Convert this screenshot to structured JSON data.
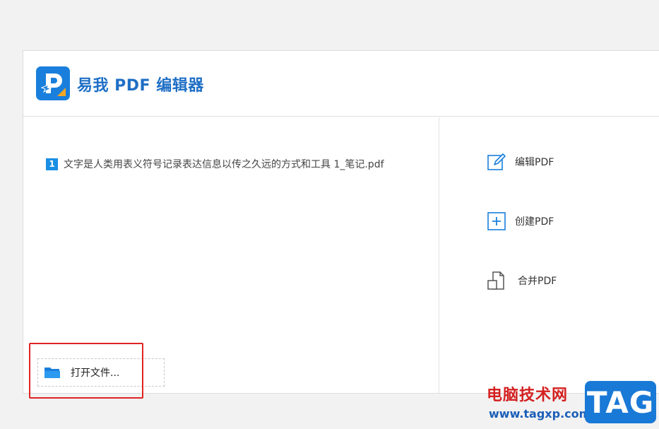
{
  "app": {
    "title": "易我 PDF 编辑器"
  },
  "recent_files": [
    {
      "index": "1",
      "name": "文字是人类用表义符号记录表达信息以传之久远的方式和工具 1_笔记.pdf"
    }
  ],
  "open_file": {
    "label": "打开文件..."
  },
  "actions": [
    {
      "label": "编辑PDF",
      "icon": "edit-pdf-icon"
    },
    {
      "label": "创建PDF",
      "icon": "create-pdf-icon"
    },
    {
      "label": "合并PDF",
      "icon": "merge-pdf-icon"
    }
  ],
  "watermark": {
    "site": "电脑技术网",
    "url": "www.tagxp.com",
    "tag": "TAG"
  },
  "colors": {
    "brand": "#1f6fc5",
    "accent": "#1a8fe3",
    "highlight": "#e02424"
  }
}
